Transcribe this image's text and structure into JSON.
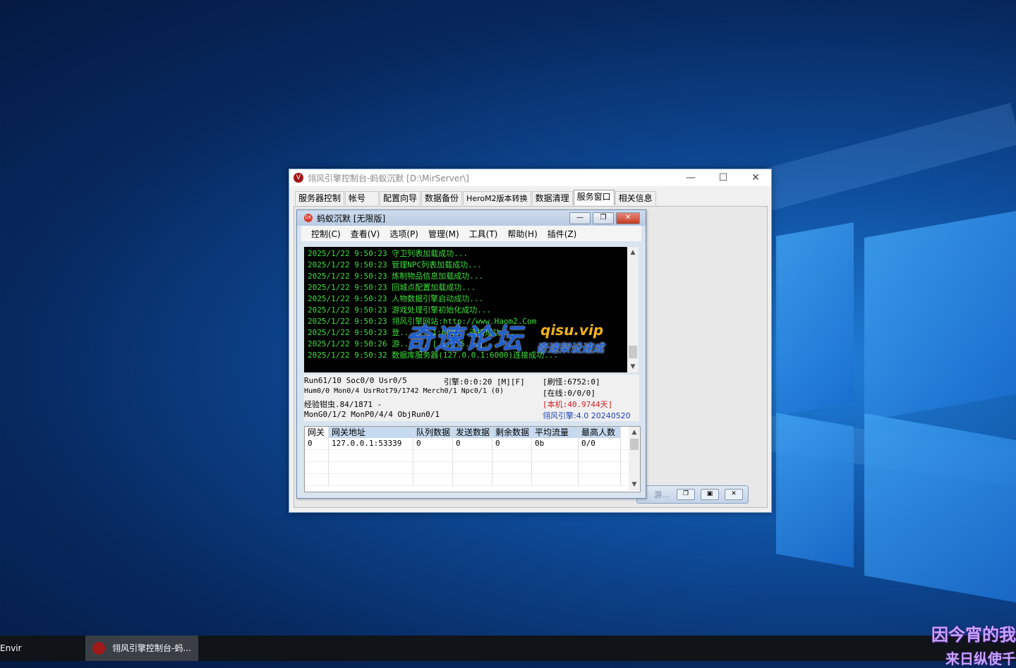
{
  "main_window": {
    "title": "翎风引擎控制台-蚂蚁沉默 [D:\\MirServer\\]",
    "icon_letter": "V",
    "controls": {
      "minimize": "—",
      "maximize": "☐",
      "close": "✕"
    },
    "tabs": [
      "服务器控制",
      "帐号",
      "配置向导",
      "数据备份",
      "HeroM2版本转换",
      "数据清理",
      "服务窗口",
      "相关信息"
    ],
    "active_tab": "服务窗口"
  },
  "child_window": {
    "title": "蚂蚁沉默 [无限版]",
    "icon_text": "DK",
    "menu": [
      "控制(C)",
      "查看(V)",
      "选项(P)",
      "管理(M)",
      "工具(T)",
      "帮助(H)",
      "插件(Z)"
    ]
  },
  "log": [
    "2025/1/22 9:50:23 守卫列表加载成功...",
    "2025/1/22 9:50:23 管理NPC列表加载成功...",
    "2025/1/22 9:50:23 炼制物品信息加载成功...",
    "2025/1/22 9:50:23 回城点配置加载成功...",
    "2025/1/22 9:50:23 人物数据引擎启动成功...",
    "2025/1/22 9:50:23 游戏处理引擎初始化成功...",
    "2025/1/22 9:50:23 翎风引擎网站:http://www.Haom2.Com",
    "2025/1/22 9:50:23 登...... 1:600...连接成功...",
    "2025/1/22 9:50:26 游...... [...1:5...]...",
    "2025/1/22 9:50:32 数据库服务器(127.0.0.1:6000)连接成功..."
  ],
  "stats": {
    "run": "Run61/10 Soc0/0 Usr0/5",
    "engine_time": "引擎:0:0:20 [M][F]",
    "refresh": "[刷怪:6752:0]",
    "hum": "Hum0/0 Mon0/4 UsrRot79/1742 Merch0/1 Npc0/1 (0)",
    "online": "[在线:0/0/0]",
    "exp": "经验钳虫.84/1871 -",
    "local": "[本机:40.9744天]",
    "mon": "MonG0/1/2 MonP0/4/4 ObjRun0/1",
    "version": "翎风引擎:4.0 20240520"
  },
  "gateway_table": {
    "headers": [
      "网关",
      "网关地址",
      "队列数据",
      "发送数据",
      "剩余数据",
      "平均流量",
      "最高人数"
    ],
    "rows": [
      [
        "0",
        "127.0.0.1:53339",
        "0",
        "0",
        "0",
        "0b",
        "0/0"
      ]
    ]
  },
  "minimized_child": {
    "label": "游..."
  },
  "watermark": {
    "main": "奇速论坛",
    "url": "qisu.vip",
    "tagline": "奇速架设速成"
  },
  "taskbar": {
    "left_label": "Envir",
    "task_label": "翎风引擎控制台-蚂..."
  },
  "caption": {
    "line1": "因今宵的我",
    "line2": "来日纵使千"
  },
  "colors": {
    "log_text": "#3ee03e",
    "local_red": "#d02020",
    "version_blue": "#1a3fb8",
    "accent": "#1f5fcf"
  }
}
